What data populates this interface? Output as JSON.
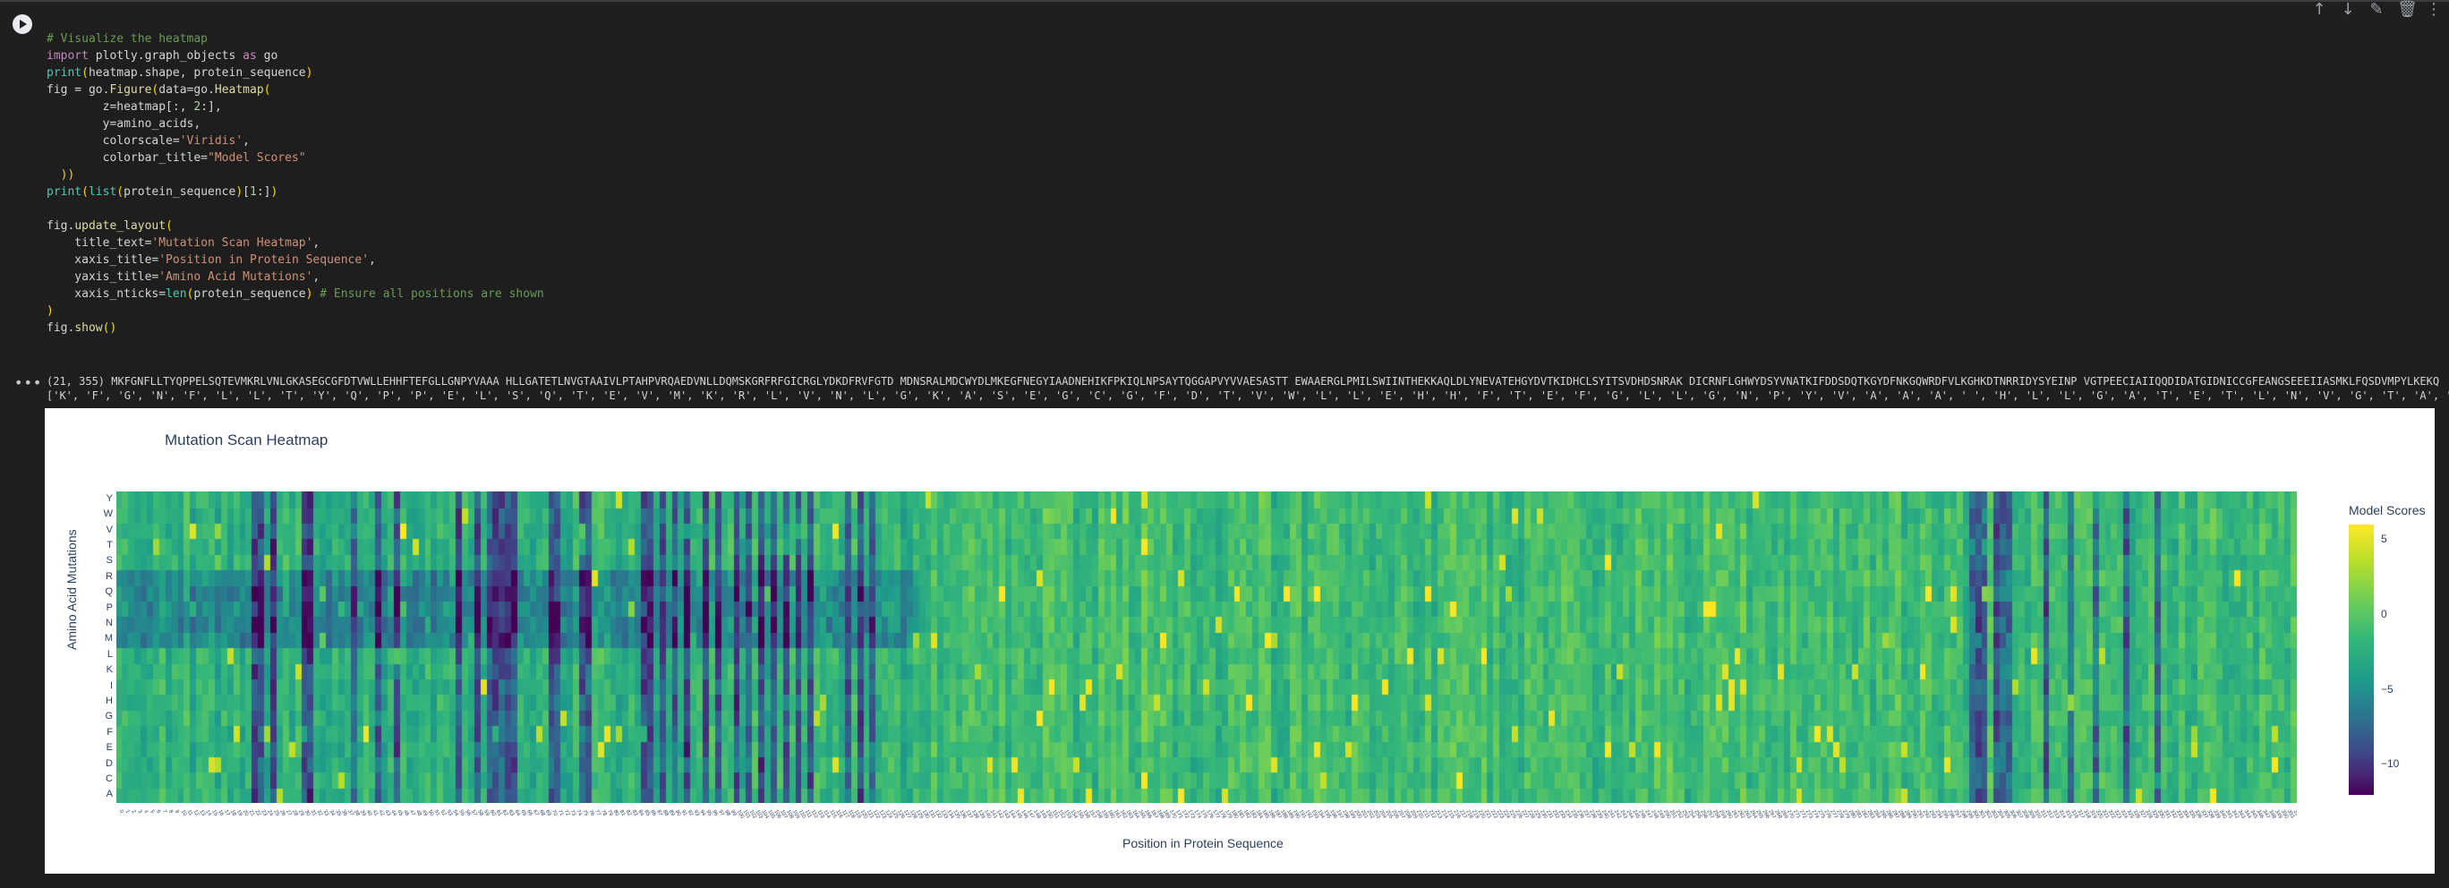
{
  "cell": {
    "toolbar_icons": [
      "arrow-up-icon",
      "arrow-down-icon",
      "pencil-icon",
      "trash-icon",
      "more-vert-icon"
    ],
    "code_lines": [
      "# Visualize the heatmap",
      "import plotly.graph_objects as go",
      "print(heatmap.shape, protein_sequence)",
      "fig = go.Figure(data=go.Heatmap(",
      "        z=heatmap[:, 2:],",
      "        y=amino_acids,",
      "        colorscale='Viridis',",
      "        colorbar_title=\"Model Scores\"",
      "  ))",
      "print(list(protein_sequence)[1:])",
      "",
      "fig.update_layout(",
      "    title_text='Mutation Scan Heatmap',",
      "    xaxis_title='Position in Protein Sequence',",
      "    yaxis_title='Amino Acid Mutations',",
      "    xaxis_nticks=len(protein_sequence) # Ensure all positions are shown",
      ")",
      "fig.show()"
    ]
  },
  "output": {
    "gutter": "•••",
    "line1": "(21, 355) MKFGNFLLTYQPPELSQTEVMKRLVNLGKASEGCGFDTVWLLEHHFTEFGLLGNPYVAAA HLLGATETLNVGTAAIVLPTAHPVRQAEDVNLLDQMSKGRFRFGICRGLYDKDFRVFGTD MDNSRALMDCWYDLMKEGFNEGYIAADNEHIKFPKIQLNPSAYTQGGAPVYVVAESASTT EWAAERGLPMILSWIINTHEKKAQLDLYNEVATEHGYDVTKIDHCLSYITSVDHDSNRAK DICRNFLGHWYDSYVNATKIFDDSDQTKGYDFNKGQWRDFVLKGHKDTNRRIDYSYEINP VGTPEECIAIIQQDIDATGIDNICCGFEANGSEEEIIASMKLFQSDVMPYLKEKQ",
    "line2": "['K', 'F', 'G', 'N', 'F', 'L', 'L', 'T', 'Y', 'Q', 'P', 'P', 'E', 'L', 'S', 'Q', 'T', 'E', 'V', 'M', 'K', 'R', 'L', 'V', 'N', 'L', 'G', 'K', 'A', 'S', 'E', 'G', 'C', 'G', 'F', 'D', 'T', 'V', 'W', 'L', 'L', 'E', 'H', 'H', 'F', 'T', 'E', 'F', 'G', 'L', 'L', 'G', 'N', 'P', 'Y', 'V', 'A', 'A', 'A', ' ', 'H', 'L', 'L', 'G', 'A', 'T', 'E', 'T', 'L', 'N', 'V', 'G', 'T', 'A', 'A', 'I', 'V', 'L', 'P', 'T', 'A', 'H', 'P', 'V', 'R', 'Q', 'A', 'E', 'D', 'V', 'N', 'L', 'L', 'D', 'Q', 'M', 'S', 'K', 'G', 'R', 'F', 'R', 'F', 'G', 'I', 'C', 'R', 'G', 'L', 'Y', 'D', 'K', 'D', 'F', 'R', 'V', 'F', 'G', 'T', 'D']"
  },
  "plot": {
    "title": "Mutation Scan Heatmap",
    "xlabel": "Position in Protein Sequence",
    "ylabel": "Amino Acid Mutations",
    "colorbar_title": "Model Scores",
    "colorbar_ticks": [
      "5",
      "0",
      "−5",
      "−10"
    ],
    "colorscale": "Viridis"
  },
  "chart_data": {
    "type": "heatmap",
    "title": "Mutation Scan Heatmap",
    "xlabel": "Position in Protein Sequence",
    "ylabel": "Amino Acid Mutations",
    "y_categories": [
      "A",
      "C",
      "D",
      "E",
      "F",
      "G",
      "H",
      "I",
      "K",
      "L",
      "M",
      "N",
      "P",
      "Q",
      "R",
      "S",
      "T",
      "V",
      "W",
      "Y"
    ],
    "x_count": 353,
    "zlim": [
      -12,
      6
    ],
    "colorbar_ticks": [
      5,
      0,
      -5,
      -10
    ],
    "columns_low": [
      22,
      23,
      25,
      30,
      31,
      38,
      42,
      45,
      55,
      58,
      60,
      61,
      62,
      63,
      64,
      70,
      71,
      75,
      76,
      85,
      86,
      88,
      90,
      92,
      95,
      97,
      100,
      102,
      104,
      106,
      108,
      110,
      112,
      118,
      120,
      122,
      300,
      301,
      302,
      304,
      305,
      306,
      312,
      316,
      320,
      325,
      330
    ],
    "rows_low": [
      "P",
      "Q",
      "R",
      "N",
      "M"
    ],
    "typical_value": 0
  }
}
